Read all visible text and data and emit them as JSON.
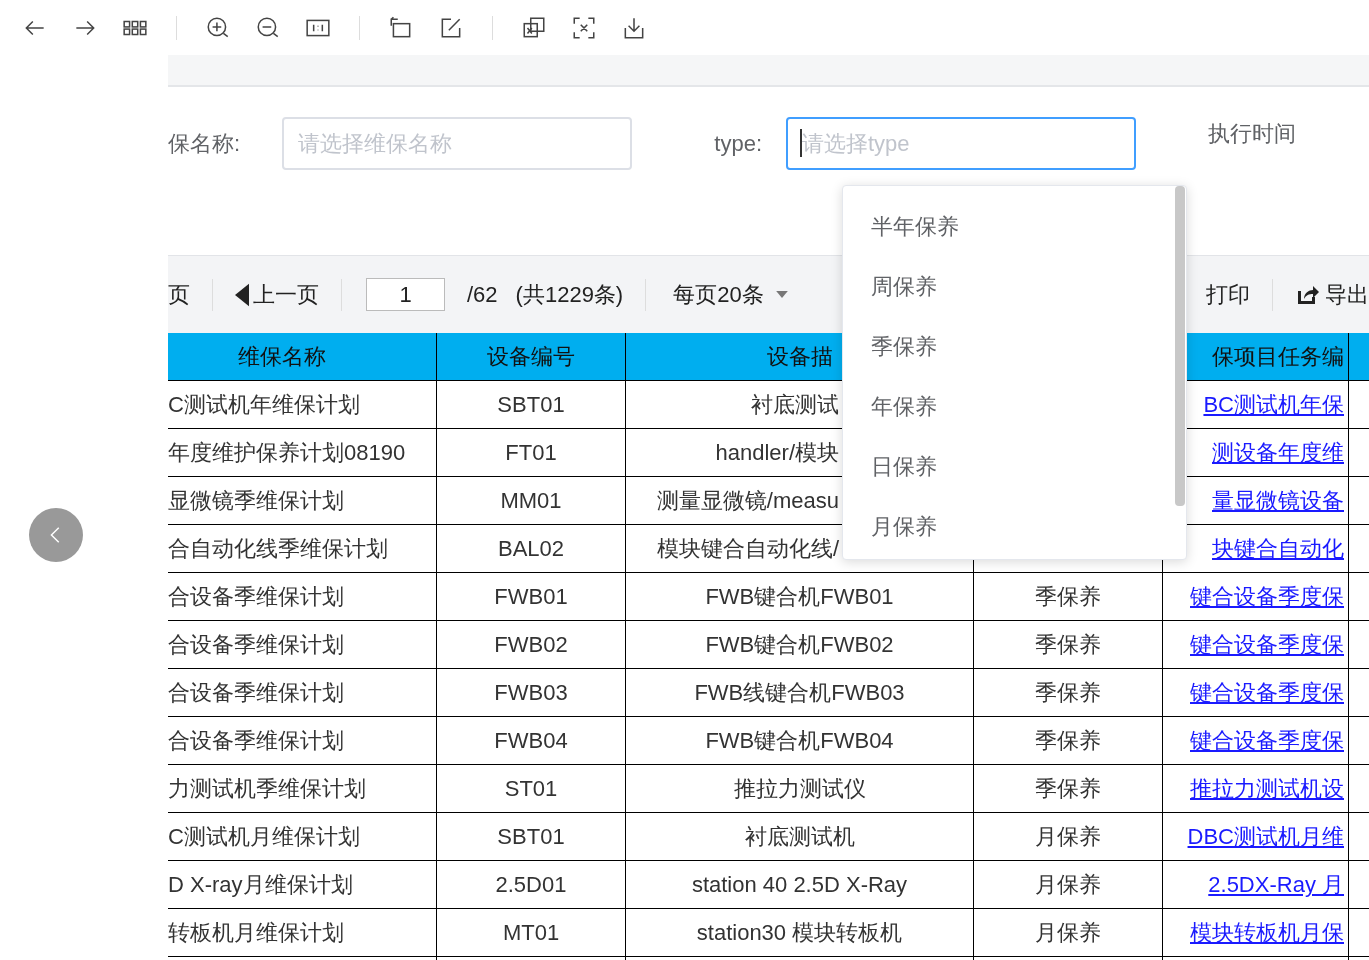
{
  "filters": [
    {
      "label": "保名称:",
      "placeholder": "请选择维保名称",
      "focused": false
    },
    {
      "label": "type:",
      "placeholder": "请选择type",
      "focused": true
    }
  ],
  "filter_cut_label": "执行时间",
  "pagination": {
    "first_cut": "页",
    "prev": "上一页",
    "page": "1",
    "total_pages": "/62",
    "total_count": "(共1229条)",
    "page_size": "每页20条",
    "print": "打印",
    "export": "导出"
  },
  "table": {
    "header": {
      "name": "维保名称",
      "code": "设备编号",
      "description": "设备描",
      "task": "保项目任务编"
    },
    "rows": [
      {
        "name": "C测试机年维保计划",
        "code": "SBT01",
        "description": "衬底测试",
        "task": "BC测试机年保"
      },
      {
        "name": "年度维护保养计划08190",
        "code": "FT01",
        "description": "handler/模块",
        "task": "测设备年度维"
      },
      {
        "name": "显微镜季维保计划",
        "code": "MM01",
        "description": "测量显微镜/measu",
        "task": "量显微镜设备"
      },
      {
        "name": "合自动化线季维保计划",
        "code": "BAL02",
        "description": "模块键合自动化线/",
        "task": "块键合自动化"
      },
      {
        "name": "合设备季维保计划",
        "code": "FWB01",
        "description": "FWB键合机FWB01",
        "type": "季保养",
        "task": "键合设备季度保"
      },
      {
        "name": "合设备季维保计划",
        "code": "FWB02",
        "description": "FWB键合机FWB02",
        "type": "季保养",
        "task": "键合设备季度保"
      },
      {
        "name": "合设备季维保计划",
        "code": "FWB03",
        "description": "FWB线键合机FWB03",
        "type": "季保养",
        "task": "键合设备季度保"
      },
      {
        "name": "合设备季维保计划",
        "code": "FWB04",
        "description": "FWB键合机FWB04",
        "type": "季保养",
        "task": "键合设备季度保"
      },
      {
        "name": "力测试机季维保计划",
        "code": "ST01",
        "description": "推拉力测试仪",
        "type": "季保养",
        "task": "推拉力测试机设"
      },
      {
        "name": "C测试机月维保计划",
        "code": "SBT01",
        "description": "衬底测试机",
        "type": "月保养",
        "task": "DBC测试机月维"
      },
      {
        "name": "D X-ray月维保计划",
        "code": "2.5D01",
        "description": "station 40 2.5D X-Ray",
        "type": "月保养",
        "task": "2.5DX-Ray 月"
      },
      {
        "name": "转板机月维保计划",
        "code": "MT01",
        "description": "station30 模块转板机",
        "type": "月保养",
        "task": "模块转板机月保"
      }
    ]
  },
  "dropdown": {
    "options": [
      {
        "label": "半年保养",
        "selected": false
      },
      {
        "label": "周保养",
        "selected": false
      },
      {
        "label": "季保养",
        "selected": false
      },
      {
        "label": "年保养",
        "selected": false
      },
      {
        "label": "日保养",
        "selected": false
      },
      {
        "label": "月保养",
        "selected": false
      }
    ]
  }
}
